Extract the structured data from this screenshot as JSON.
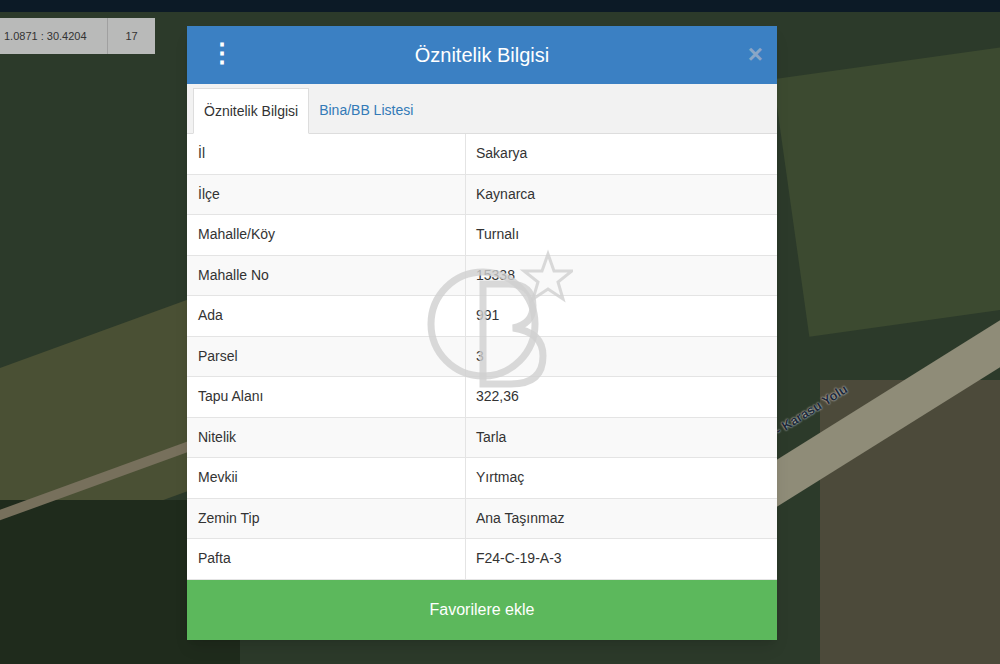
{
  "map": {
    "coordinates": "1.0871 : 30.4204",
    "zoom": "17",
    "road_label": "- Karasu Yolu"
  },
  "dialog": {
    "title": "Öznitelik Bilgisi",
    "menu_icon": "⋮",
    "close_icon": "×"
  },
  "tabs": [
    {
      "label": "Öznitelik Bilgisi",
      "selected": true
    },
    {
      "label": "Bina/BB Listesi",
      "selected": false
    }
  ],
  "rows": [
    {
      "label": "İl",
      "value": "Sakarya"
    },
    {
      "label": "İlçe",
      "value": "Kaynarca"
    },
    {
      "label": "Mahalle/Köy",
      "value": "Turnalı"
    },
    {
      "label": "Mahalle No",
      "value": "15338"
    },
    {
      "label": "Ada",
      "value": "991"
    },
    {
      "label": "Parsel",
      "value": "3"
    },
    {
      "label": "Tapu Alanı",
      "value": "322,36"
    },
    {
      "label": "Nitelik",
      "value": "Tarla"
    },
    {
      "label": "Mevkii",
      "value": "Yırtmaç"
    },
    {
      "label": "Zemin Tip",
      "value": "Ana Taşınmaz"
    },
    {
      "label": "Pafta",
      "value": "F24-C-19-A-3"
    }
  ],
  "buttons": [
    "Favorilere ekle"
  ]
}
